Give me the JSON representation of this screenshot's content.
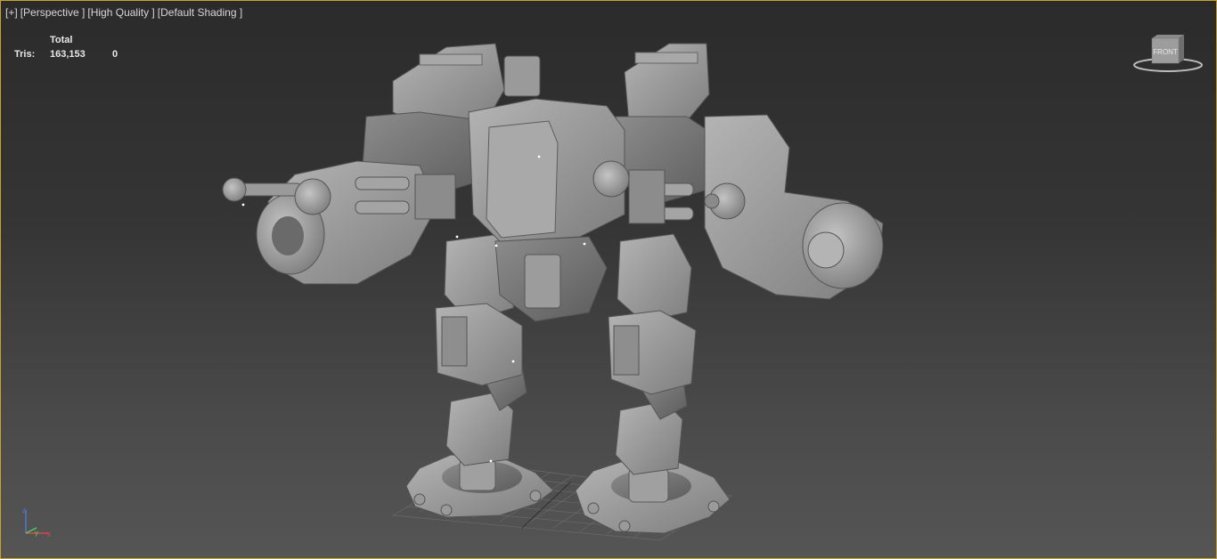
{
  "viewport": {
    "menu": {
      "plus": "[+]",
      "view": "[Perspective ]",
      "quality": "[High Quality ]",
      "shading": "[Default Shading ]"
    },
    "stats": {
      "header": "Total",
      "tris_label": "Tris:",
      "tris_value": "163,153",
      "tris_selected": "0"
    },
    "viewcube_label": "FRONT",
    "border_color": "#c9a227",
    "model_color": "#9a9a9a"
  }
}
